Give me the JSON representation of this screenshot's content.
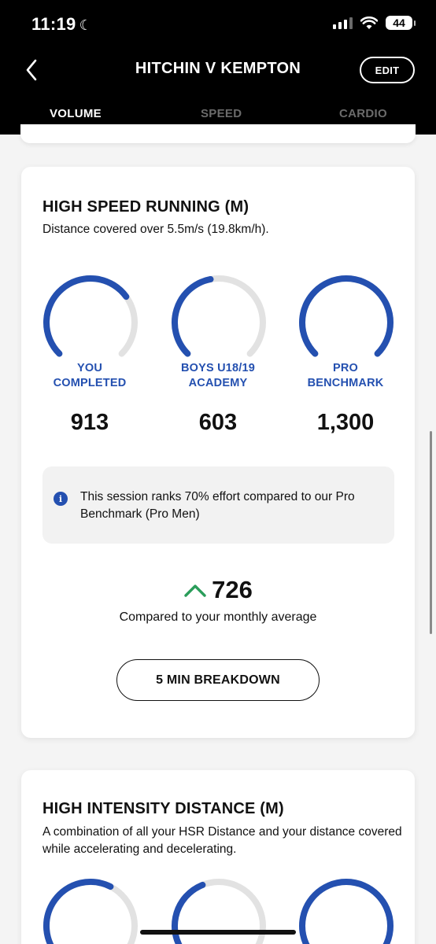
{
  "status_bar": {
    "time": "11:19",
    "moon_glyph": "☾",
    "battery": "44"
  },
  "header": {
    "title": "HITCHIN V KEMPTON",
    "edit_label": "EDIT",
    "tabs": [
      {
        "label": "VOLUME",
        "active": true
      },
      {
        "label": "SPEED",
        "active": false
      },
      {
        "label": "CARDIO",
        "active": false
      }
    ]
  },
  "colors": {
    "accent": "#2450b0",
    "track": "#e2e2e2",
    "up_arrow": "#2a9d5a"
  },
  "cards": [
    {
      "title": "HIGH SPEED RUNNING (M)",
      "description": "Distance covered over 5.5m/s (19.8km/h).",
      "gauges": [
        {
          "label_line1": "YOU",
          "label_line2": "COMPLETED",
          "value": "913",
          "fill": 0.7
        },
        {
          "label_line1": "BOYS U18/19",
          "label_line2": "ACADEMY",
          "value": "603",
          "fill": 0.46
        },
        {
          "label_line1": "PRO",
          "label_line2": "BENCHMARK",
          "value": "1,300",
          "fill": 1.0
        }
      ],
      "info_text": "This session ranks 70% effort compared to our Pro Benchmark (Pro Men)",
      "delta_value": "726",
      "delta_caption": "Compared to your monthly average",
      "button_label": "5 MIN BREAKDOWN"
    },
    {
      "title": "HIGH INTENSITY DISTANCE (M)",
      "description": "A combination of all your HSR Distance and your distance covered while accelerating and decelerating.",
      "gauges": [
        {
          "fill": 0.6
        },
        {
          "fill": 0.42
        },
        {
          "fill": 1.0
        }
      ]
    }
  ]
}
